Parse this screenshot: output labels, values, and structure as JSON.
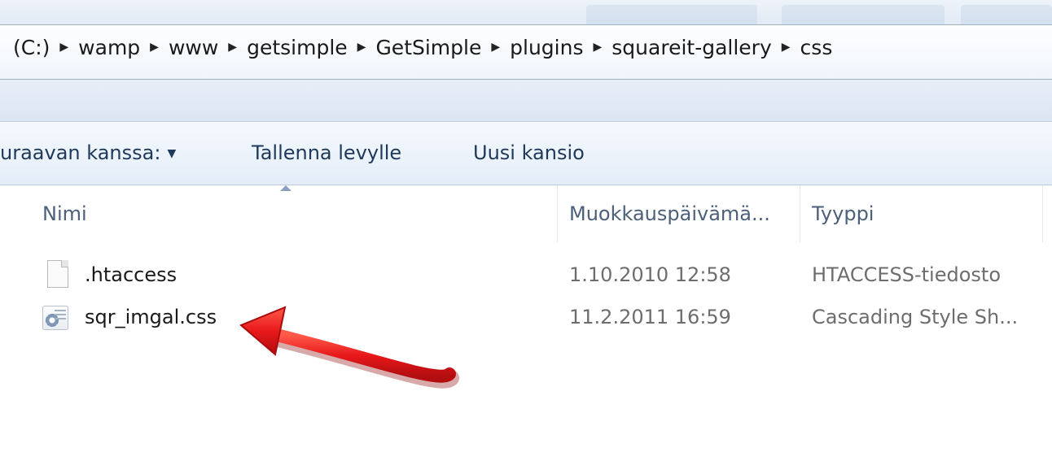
{
  "address_bar": {
    "path": [
      "(C:)",
      "wamp",
      "www",
      "getsimple",
      "GetSimple",
      "plugins",
      "squareit-gallery",
      "css"
    ]
  },
  "command_bar": {
    "open_with_label": "uraavan kanssa:",
    "save_label": "Tallenna levylle",
    "new_folder_label": "Uusi kansio"
  },
  "columns": {
    "name": "Nimi",
    "modified": "Muokkauspäivämä...",
    "type": "Tyyppi"
  },
  "files": [
    {
      "name": ".htaccess",
      "modified": "1.10.2010 12:58",
      "type": "HTACCESS-tiedosto",
      "icon": "blank-file-icon"
    },
    {
      "name": "sqr_imgal.css",
      "modified": "11.2.2011 16:59",
      "type": "Cascading Style Sh...",
      "icon": "css-file-icon"
    }
  ],
  "annotation": {
    "color": "#e8181b",
    "icon": "red-arrow"
  }
}
